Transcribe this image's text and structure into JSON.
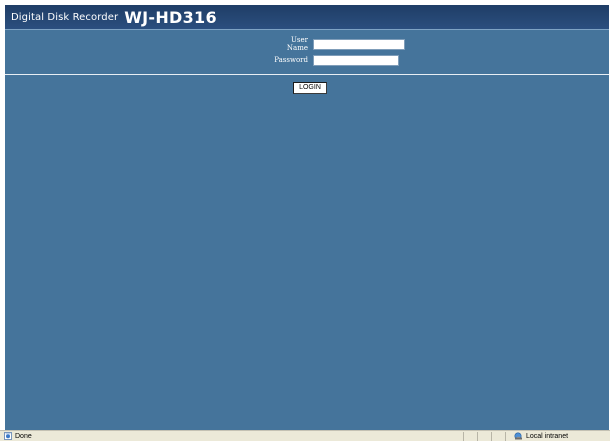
{
  "header": {
    "subtitle": "Digital Disk Recorder",
    "model": "WJ-HD316"
  },
  "login": {
    "username_label": "User Name",
    "username_value": "",
    "password_label": "Password",
    "password_value": "",
    "button_label": "LOGIN"
  },
  "statusbar": {
    "status_text": "Done",
    "zone_text": "Local intranet",
    "icons": {
      "page": "ie-page-icon",
      "zone": "local-intranet-icon"
    }
  },
  "colors": {
    "background": "#45749b",
    "header": "#2b4f7f",
    "statusbar": "#ece9d8"
  }
}
